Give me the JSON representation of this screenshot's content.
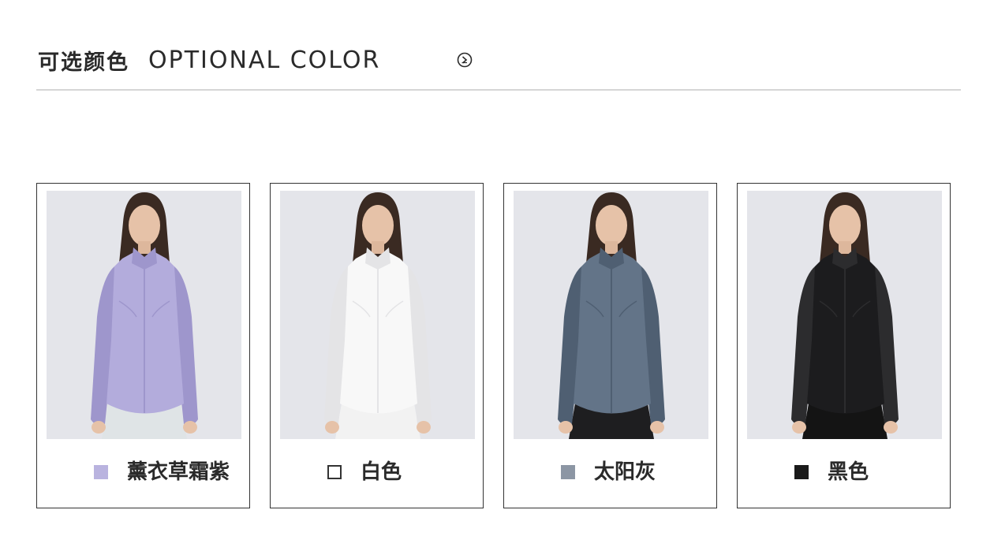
{
  "header": {
    "title_cn": "可选颜色",
    "title_en": "OPTIONAL COLOR",
    "arrow_icon": "circle-chevron-right-icon"
  },
  "colors": [
    {
      "name": "薰衣草霜紫",
      "swatch": "#b9b3df",
      "jacket": "#b3acdc",
      "jacket_shade": "#9e96cc",
      "pants": "#dfe4e6"
    },
    {
      "name": "白色",
      "swatch": "#ffffff",
      "swatch_border": "#333333",
      "jacket": "#f8f8f8",
      "jacket_shade": "#e4e4e6",
      "pants": "#f2f2f2"
    },
    {
      "name": "太阳灰",
      "swatch": "#8c96a4",
      "jacket": "#637488",
      "jacket_shade": "#4f5f72",
      "pants": "#1e1e20"
    },
    {
      "name": "黑色",
      "swatch": "#1a1a1a",
      "jacket": "#1c1c1e",
      "jacket_shade": "#2c2c2e",
      "pants": "#141414"
    }
  ]
}
